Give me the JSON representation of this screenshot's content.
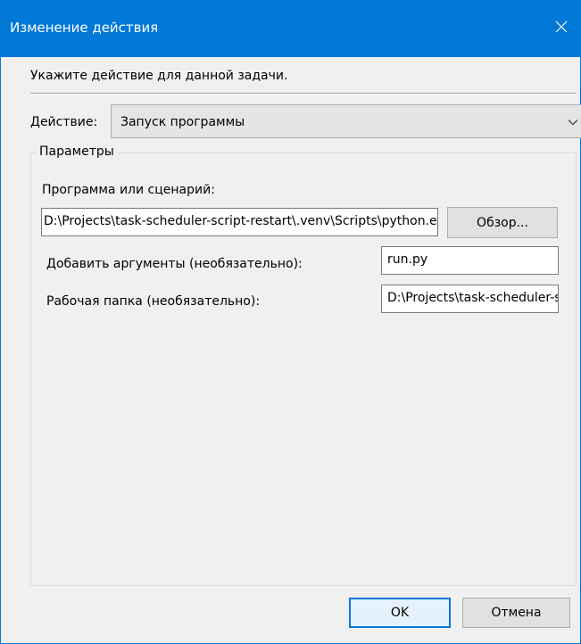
{
  "window": {
    "title": "Изменение действия"
  },
  "prompt": "Укажите действие для данной задачи.",
  "action": {
    "label": "Действие:",
    "selected": "Запуск программы"
  },
  "params": {
    "legend": "Параметры",
    "program_label": "Программа или сценарий:",
    "program_value": "D:\\Projects\\task-scheduler-script-restart\\.venv\\Scripts\\python.exe",
    "browse_label": "Обзор...",
    "args_label": "Добавить аргументы (необязательно):",
    "args_value": "run.py",
    "dir_label": "Рабочая папка (необязательно):",
    "dir_value": "D:\\Projects\\task-scheduler-script-restart"
  },
  "footer": {
    "ok_label": "OK",
    "cancel_label": "Отмена"
  },
  "colors": {
    "titlebar": "#0078d7",
    "dialog_bg": "#f0f0f0",
    "default_button_border": "#0078d7"
  },
  "icons": {
    "close": "close-icon",
    "dropdown": "chevron-down-icon"
  }
}
